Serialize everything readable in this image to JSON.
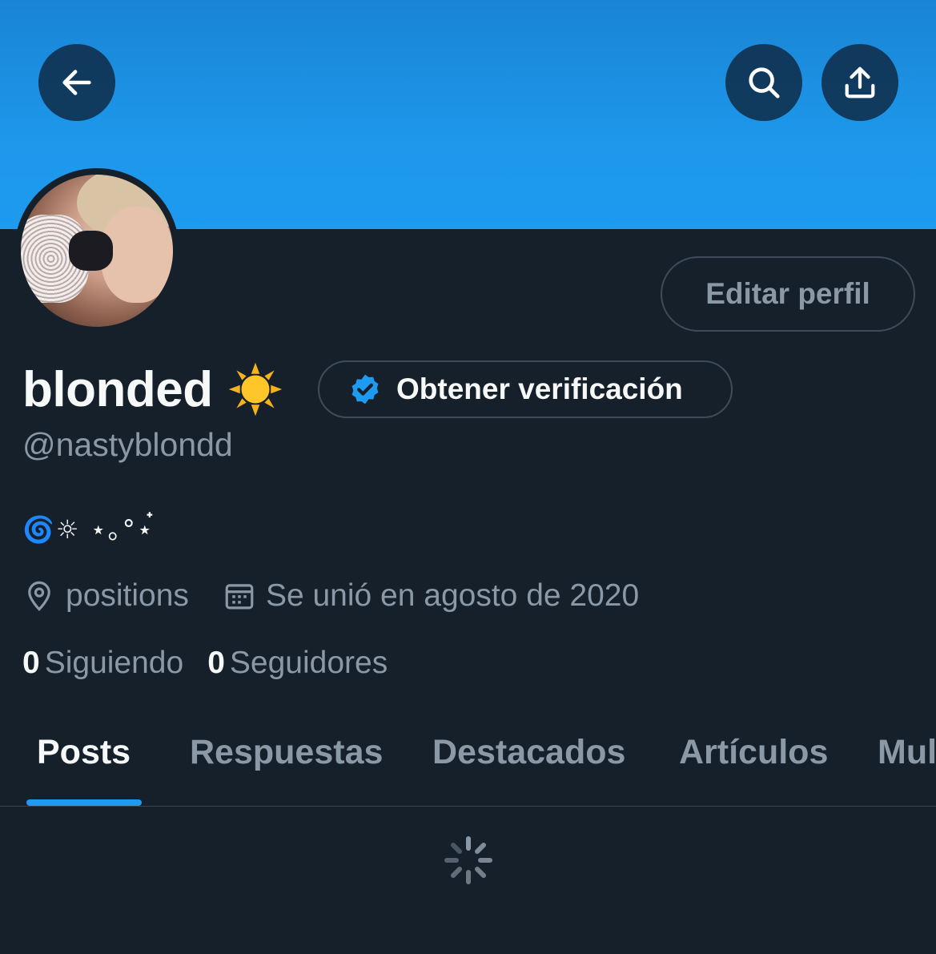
{
  "header": {
    "back_icon": "arrow-left-icon",
    "search_icon": "search-icon",
    "share_icon": "share-upload-icon",
    "banner_color": "#1d9bf0"
  },
  "profile": {
    "display_name": "blonded",
    "name_emoji_icon": "sun-icon",
    "handle": "@nastyblondd",
    "bio": "🌀☼ ⋆｡°⋆๋",
    "location": "positions",
    "joined": "Se unió en agosto de 2020",
    "edit_label": "Editar perfil",
    "verify_label": "Obtener verificación"
  },
  "stats": {
    "following_count": "0",
    "following_label": "Siguiendo",
    "followers_count": "0",
    "followers_label": "Seguidores"
  },
  "tabs": [
    {
      "label": "Posts",
      "active": true
    },
    {
      "label": "Respuestas",
      "active": false
    },
    {
      "label": "Destacados",
      "active": false
    },
    {
      "label": "Artículos",
      "active": false
    },
    {
      "label": "Mul",
      "active": false
    }
  ],
  "colors": {
    "background": "#15202b",
    "accent": "#1d9bf0",
    "secondary_text": "#8b98a5"
  }
}
